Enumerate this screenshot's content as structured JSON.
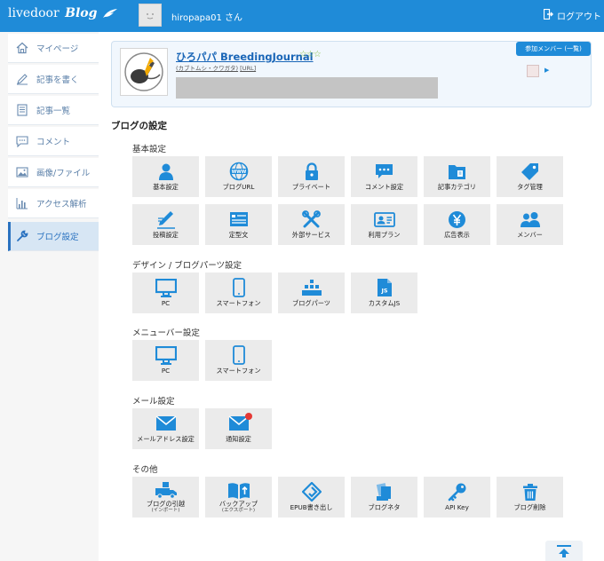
{
  "header": {
    "logo_text": "livedoor",
    "logo_brand": "Blog",
    "user_label": "hiropapa01 さん",
    "logout_label": "ログアウト"
  },
  "sidebar": {
    "items": [
      {
        "label": "マイページ",
        "icon": "home-icon"
      },
      {
        "label": "記事を書く",
        "icon": "pen-icon"
      },
      {
        "label": "記事一覧",
        "icon": "document-list-icon"
      },
      {
        "label": "コメント",
        "icon": "comment-icon"
      },
      {
        "label": "画像/ファイル",
        "icon": "image-icon"
      },
      {
        "label": "アクセス解析",
        "icon": "bar-chart-icon"
      },
      {
        "label": "ブログ設定",
        "icon": "wrench-icon",
        "active": true
      }
    ]
  },
  "blog": {
    "title": "ひろパパ BreedingJournal",
    "stars": "☆☆☆",
    "subtitle": "(カブトムシ・クワガタ)",
    "url_label": "[URL]",
    "members_button": "参加メンバー (一覧)"
  },
  "settings": {
    "title": "ブログの設定",
    "groups": [
      {
        "label": "基本設定",
        "tiles": [
          {
            "label": "基本設定",
            "icon": "user-icon"
          },
          {
            "label": "ブログURL",
            "icon": "www-globe-icon"
          },
          {
            "label": "プライベート",
            "icon": "lock-icon"
          },
          {
            "label": "コメント設定",
            "icon": "speech-bubble-icon"
          },
          {
            "label": "記事カテゴリ",
            "icon": "folder-icon"
          },
          {
            "label": "タグ管理",
            "icon": "tag-icon"
          },
          {
            "label": "投稿設定",
            "icon": "pencil-note-icon"
          },
          {
            "label": "定型文",
            "icon": "template-icon"
          },
          {
            "label": "外部サービス",
            "icon": "tools-icon"
          },
          {
            "label": "利用プラン",
            "icon": "id-card-icon"
          },
          {
            "label": "広告表示",
            "icon": "yen-coin-icon"
          },
          {
            "label": "メンバー",
            "icon": "members-icon"
          }
        ]
      },
      {
        "label": "デザイン / ブログパーツ設定",
        "tiles": [
          {
            "label": "PC",
            "icon": "monitor-icon"
          },
          {
            "label": "スマートフォン",
            "icon": "smartphone-icon"
          },
          {
            "label": "ブログパーツ",
            "icon": "blog-parts-icon"
          },
          {
            "label": "カスタムJS",
            "icon": "js-file-icon"
          }
        ]
      },
      {
        "label": "メニューバー設定",
        "tiles": [
          {
            "label": "PC",
            "icon": "monitor-icon"
          },
          {
            "label": "スマートフォン",
            "icon": "smartphone-icon"
          }
        ]
      },
      {
        "label": "メール設定",
        "tiles": [
          {
            "label": "メールアドレス設定",
            "icon": "envelope-icon"
          },
          {
            "label": "通知設定",
            "icon": "envelope-notification-icon"
          }
        ]
      },
      {
        "label": "その他",
        "tiles": [
          {
            "label": "ブログの引越",
            "sub": "(インポート)",
            "icon": "moving-truck-icon"
          },
          {
            "label": "バックアップ",
            "sub": "(エクスポート)",
            "icon": "book-upload-icon"
          },
          {
            "label": "EPUB書き出し",
            "icon": "epub-icon"
          },
          {
            "label": "ブログネタ",
            "icon": "cards-icon"
          },
          {
            "label": "API Key",
            "icon": "key-icon"
          },
          {
            "label": "ブログ削除",
            "icon": "trash-icon"
          }
        ]
      }
    ]
  },
  "colors": {
    "header_bg": "#1f8bd8",
    "icon_blue": "#1f8bd8",
    "tile_bg": "#ebebeb",
    "badge_red": "#e53935"
  }
}
